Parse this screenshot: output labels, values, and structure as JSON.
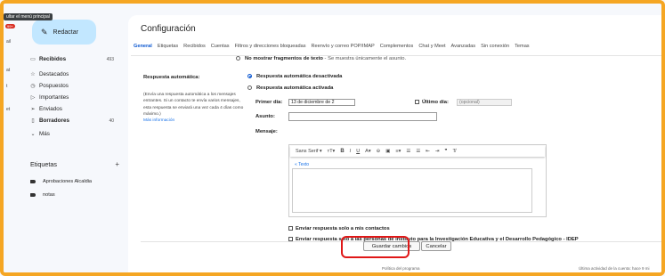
{
  "rail": {
    "tooltip": "ultar el menú principal",
    "badge": "99+",
    "items": [
      "ail",
      "at",
      "t",
      "et"
    ]
  },
  "compose_label": "Redactar",
  "nav": [
    {
      "label": "Recibidos",
      "count": "493",
      "icon": "inbox-icon",
      "glyph": "▭",
      "bold": true
    },
    {
      "label": "Destacados",
      "count": "",
      "icon": "star-icon",
      "glyph": "☆",
      "bold": false
    },
    {
      "label": "Pospuestos",
      "count": "",
      "icon": "clock-icon",
      "glyph": "◷",
      "bold": false
    },
    {
      "label": "Importantes",
      "count": "",
      "icon": "important-icon",
      "glyph": "▷",
      "bold": false
    },
    {
      "label": "Enviados",
      "count": "",
      "icon": "send-icon",
      "glyph": "➢",
      "bold": false
    },
    {
      "label": "Borradores",
      "count": "40",
      "icon": "draft-icon",
      "glyph": "▯",
      "bold": true
    },
    {
      "label": "Más",
      "count": "",
      "icon": "chevron-down-icon",
      "glyph": "⌄",
      "bold": false
    }
  ],
  "labels": {
    "heading": "Etiquetas",
    "add": "+",
    "items": [
      "Aprobaciones Alcaldia",
      "notas"
    ]
  },
  "page_title": "Configuración",
  "tabs": [
    "General",
    "Etiquetas",
    "Recibidos",
    "Cuentas",
    "Filtros y direcciones bloqueadas",
    "Reenvío y correo POP/IMAP",
    "Complementos",
    "Chat y Meet",
    "Avanzadas",
    "Sin conexión",
    "Temas"
  ],
  "snippets": {
    "option_bold": "No mostrar fragmentos de texto",
    "option_rest": " - Se muestra únicamente el asunto."
  },
  "autoreply": {
    "heading": "Respuesta automática:",
    "description": "(Envía una respuesta automática a los mensajes entrantes. Si un contacto te envía varios mensajes, esta respuesta se enviará una vez cada 4 días como máximo.)",
    "more_info": "Más información",
    "off_label": "Respuesta automática desactivada",
    "on_label": "Respuesta automática activada",
    "first_day_label": "Primer día:",
    "first_day_value": "13 de diciembre de 2",
    "last_day_label": "Último día:",
    "last_day_placeholder": "(opcional)",
    "subject_label": "Asunto:",
    "subject_value": "",
    "message_label": "Mensaje:",
    "font": "Sans Serif",
    "rich_text": "« Texto",
    "contacts_only": "Enviar respuesta solo a mis contactos",
    "org_only": "Enviar respuesta solo a las personas de Instituto para la Investigación Educativa y el Desarrollo Pedagógico - IDEP"
  },
  "buttons": {
    "save": "Guardar cambios",
    "cancel": "Cancelar"
  },
  "footer": {
    "policy": "Política del programa",
    "activity": "Última actividad de la cuenta: hace 9 mi"
  },
  "colors": {
    "accent": "#0b57d0",
    "highlight": "#e01818",
    "border": "#f5a623"
  }
}
